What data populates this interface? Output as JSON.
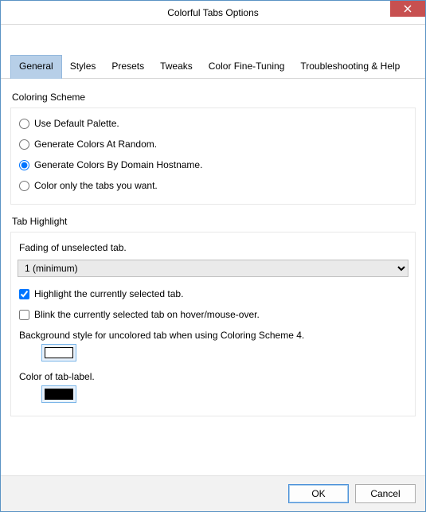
{
  "window": {
    "title": "Colorful Tabs Options"
  },
  "tabs": [
    {
      "label": "General",
      "active": true
    },
    {
      "label": "Styles",
      "active": false
    },
    {
      "label": "Presets",
      "active": false
    },
    {
      "label": "Tweaks",
      "active": false
    },
    {
      "label": "Color Fine-Tuning",
      "active": false
    },
    {
      "label": "Troubleshooting & Help",
      "active": false
    }
  ],
  "coloring_scheme": {
    "legend": "Coloring Scheme",
    "options": [
      {
        "label": "Use Default Palette.",
        "selected": false
      },
      {
        "label": "Generate Colors At Random.",
        "selected": false
      },
      {
        "label": "Generate Colors By Domain Hostname.",
        "selected": true
      },
      {
        "label": "Color only the tabs you want.",
        "selected": false
      }
    ]
  },
  "tab_highlight": {
    "legend": "Tab Highlight",
    "fading_label": "Fading of unselected tab.",
    "fading_value": "1 (minimum)",
    "highlight_selected": {
      "label": "Highlight the currently selected tab.",
      "checked": true
    },
    "blink_hover": {
      "label": "Blink the currently selected tab on hover/mouse-over.",
      "checked": false
    },
    "bg_style_label": "Background style for uncolored tab when using Coloring Scheme 4.",
    "bg_style_color": "#ffffff",
    "label_color_label": "Color of tab-label.",
    "label_color": "#000000"
  },
  "buttons": {
    "ok": "OK",
    "cancel": "Cancel"
  }
}
